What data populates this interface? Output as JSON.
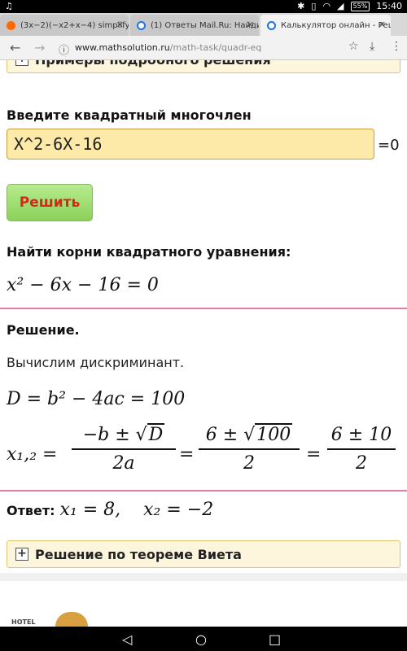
{
  "status": {
    "left_icon": "music-icon",
    "battery": "55%",
    "time": "15:40"
  },
  "tabs": [
    {
      "title": "(3x−2)(−x2+x−4) simplify -",
      "icon_color": "#ff6a00"
    },
    {
      "title": "(1) Ответы Mail.Ru: Найди",
      "icon_color": "#1a73e8"
    },
    {
      "title": "Калькулятор онлайн - Реш",
      "icon_color": "#1a73e8"
    }
  ],
  "url": {
    "domain": "www.mathsolution.ru",
    "path": "/math-task/quadr-eq"
  },
  "page": {
    "examples_header": "Примеры подробного решения",
    "input_label": "Введите квадратный многочлен",
    "input_value": "X^2-6X-16",
    "eq_zero": "=0",
    "solve_button": "Решить",
    "roots_label": "Найти корни квадратного уравнения:",
    "equation": "x² − 6x − 16 = 0",
    "solution_label": "Решение.",
    "compute_discriminant": "Вычислим дискриминант.",
    "discriminant": "D = b² − 4ac = 100",
    "roots_lhs": "x₁,₂ =",
    "frac1_num_prefix": "−b ± √",
    "frac1_num_rad": "D",
    "frac1_den": "2a",
    "eq_sign": "=",
    "frac2_num_prefix": "6 ± √",
    "frac2_num_rad": "100",
    "frac2_den": "2",
    "frac3_num": "6 ± 10",
    "frac3_den": "2",
    "answer_label": "Ответ:",
    "answer_value": "x₁ = 8,    x₂ = −2",
    "vieta_header": "Решение по теореме Виета",
    "footer_text": "HOTEL"
  },
  "colors": {
    "accent_pink": "#e080a0",
    "button_text": "#d8261a",
    "input_bg": "#fde9a8"
  }
}
